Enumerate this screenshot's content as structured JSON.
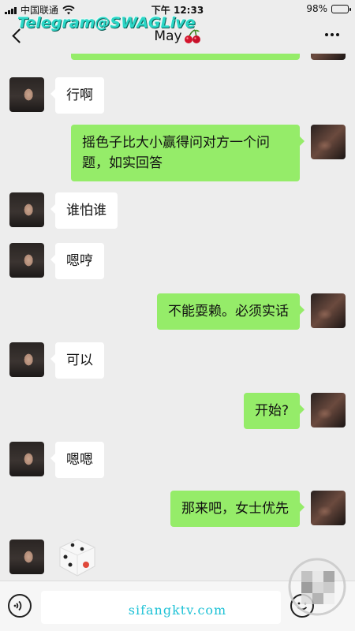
{
  "status_bar": {
    "carrier": "中国联通",
    "time": "下午 12:33",
    "battery": "98%",
    "battery_level": 0.98
  },
  "watermark": "Telegram@SWAGLive",
  "header": {
    "title": "May",
    "title_emoji_icon": "cherry-icon"
  },
  "messages": [
    {
      "side": "in",
      "text": "行啊"
    },
    {
      "side": "out",
      "text": "摇色子比大小赢得问对方一个问题，如实回答"
    },
    {
      "side": "in",
      "text": "谁怕谁"
    },
    {
      "side": "in",
      "text": "嗯哼"
    },
    {
      "side": "out",
      "text": "不能耍赖。必须实话"
    },
    {
      "side": "in",
      "text": "可以"
    },
    {
      "side": "out",
      "text": "开始?"
    },
    {
      "side": "in",
      "text": "嗯嗯"
    },
    {
      "side": "out",
      "text": "那来吧，女士优先"
    },
    {
      "side": "in",
      "type": "dice",
      "icon": "dice-icon"
    }
  ],
  "input_bar": {
    "voice_icon": "voice-icon",
    "emoji_icon": "emoji-icon"
  },
  "site_watermark": "sifangktv.com",
  "colors": {
    "outgoing_bubble": "#95ec69",
    "incoming_bubble": "#ffffff",
    "background": "#ededed"
  }
}
